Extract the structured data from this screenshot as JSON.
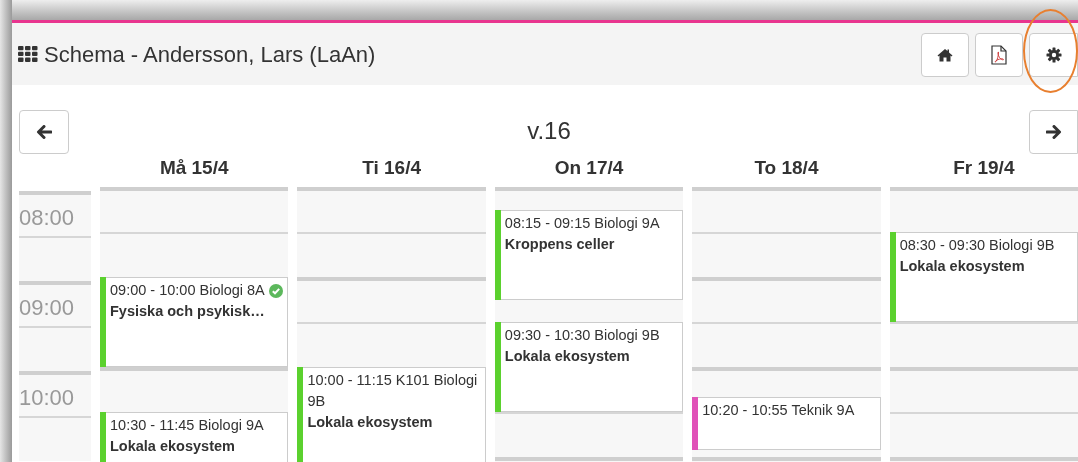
{
  "header": {
    "title": "Schema - Andersson, Lars (LaAn)",
    "buttons": [
      {
        "kind": "home",
        "highlighted": false
      },
      {
        "kind": "pdf",
        "highlighted": false
      },
      {
        "kind": "settings",
        "highlighted": true
      }
    ]
  },
  "week": {
    "label": "v.16"
  },
  "times": [
    "08:00",
    "09:00",
    "10:00"
  ],
  "days": [
    {
      "label": "Må 15/4",
      "events": [
        {
          "heading": "09:00 - 10:00 Biologi 8A",
          "title": "Fysiska och psykisk…",
          "color": "#5bd12e",
          "done": true
        },
        {
          "heading": "10:30 - 11:45 Biologi 9A",
          "title": "Lokala ekosystem",
          "color": "#5bd12e",
          "done": false
        }
      ]
    },
    {
      "label": "Ti 16/4",
      "events": [
        {
          "heading": "10:00 - 11:15 K101 Biologi 9B",
          "title": "Lokala ekosystem",
          "color": "#5bd12e",
          "done": false
        }
      ]
    },
    {
      "label": "On 17/4",
      "events": [
        {
          "heading": "08:15 - 09:15 Biologi 9A",
          "title": "Kroppens celler",
          "color": "#5bd12e",
          "done": false
        },
        {
          "heading": "09:30 - 10:30 Biologi 9B",
          "title": "Lokala ekosystem",
          "color": "#5bd12e",
          "done": false
        }
      ]
    },
    {
      "label": "To 18/4",
      "events": [
        {
          "heading": "10:20 - 10:55 Teknik 9A",
          "color": "#e052b8",
          "done": false
        }
      ]
    },
    {
      "label": "Fr 19/4",
      "events": [
        {
          "heading": "08:30 - 09:30 Biologi 9B",
          "title": "Lokala ekosystem",
          "color": "#5bd12e",
          "done": false
        }
      ]
    }
  ]
}
